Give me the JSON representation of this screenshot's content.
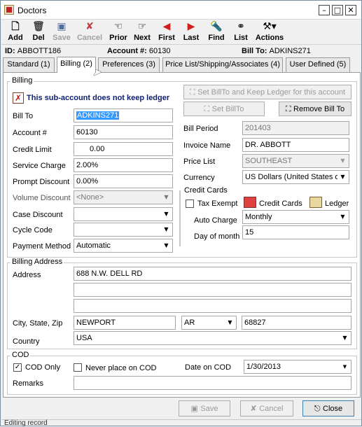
{
  "window": {
    "title": "Doctors"
  },
  "toolbar": {
    "add": "Add",
    "del": "Del",
    "save": "Save",
    "cancel": "Cancel",
    "prior": "Prior",
    "next": "Next",
    "first": "First",
    "last": "Last",
    "find": "Find",
    "list": "List",
    "actions": "Actions"
  },
  "info": {
    "id_label": "ID:",
    "id_value": "ABBOTT186",
    "account_label": "Account #:",
    "account_value": "60130",
    "billto_label": "Bill To:",
    "billto_value": "ADKINS271"
  },
  "tabs": [
    "Standard (1)",
    "Billing (2)",
    "Preferences (3)",
    "Price List/Shipping/Associates (4)",
    "User Defined (5)"
  ],
  "billing": {
    "group_title": "Billing",
    "ledger_note": "This sub-account does not keep ledger",
    "set_billto_keep_ledger": "Set BillTo and Keep Ledger for this account",
    "set_billto": "Set BillTo",
    "remove_bill_to": "Remove Bill To",
    "labels": {
      "bill_to": "Bill To",
      "account": "Account #",
      "credit_limit": "Credit Limit",
      "service_charge": "Service Charge",
      "prompt_discount": "Prompt Discount",
      "volume_discount": "Volume Discount",
      "case_discount": "Case Discount",
      "cycle_code": "Cycle Code",
      "payment_method": "Payment Method",
      "bill_period": "Bill Period",
      "invoice_name": "Invoice Name",
      "price_list": "Price List",
      "currency": "Currency"
    },
    "values": {
      "bill_to": "ADKINS271",
      "account": "60130",
      "credit_limit": "0.00",
      "service_charge": "2.00%",
      "prompt_discount": "0.00%",
      "volume_discount": "<None>",
      "case_discount": "",
      "cycle_code": "",
      "payment_method": "Automatic",
      "bill_period": "201403",
      "invoice_name": "DR. ABBOTT",
      "price_list": "SOUTHEAST",
      "currency": "US Dollars  (United States of"
    }
  },
  "credit_cards": {
    "group_title": "Credit Cards",
    "tax_exempt": "Tax Exempt",
    "credit_cards_btn": "Credit Cards",
    "ledger_btn": "Ledger",
    "auto_charge_label": "Auto Charge",
    "auto_charge_value": "Monthly",
    "day_of_month_label": "Day of month",
    "day_of_month_value": "15"
  },
  "billing_address": {
    "group_title": "Billing Address",
    "address_label": "Address",
    "address1": "688 N.W. DELL RD",
    "address2": "",
    "address3": "",
    "city_label": "City, State, Zip",
    "city": "NEWPORT",
    "state": "AR",
    "zip": "68827",
    "country_label": "Country",
    "country": "USA"
  },
  "cod": {
    "group_title": "COD",
    "cod_only": "COD Only",
    "never_cod": "Never place on COD",
    "date_label": "Date on COD",
    "date_value": "1/30/2013",
    "remarks_label": "Remarks",
    "remarks_value": ""
  },
  "footer": {
    "save": "Save",
    "cancel": "Cancel",
    "close": "Close"
  },
  "status": {
    "text": "Editing record"
  }
}
